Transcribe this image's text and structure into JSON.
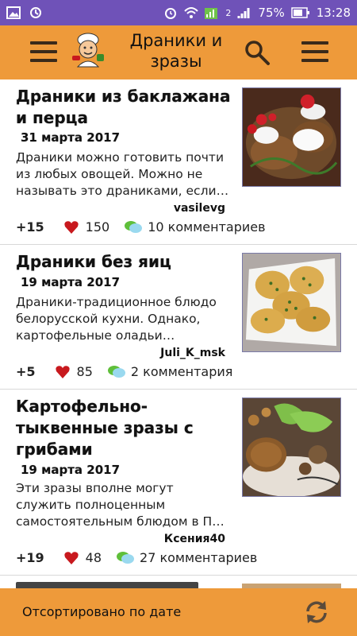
{
  "status_bar": {
    "battery": "75%",
    "time": "13:28",
    "sim_label": "2"
  },
  "app_bar": {
    "title": "Драники и зразы",
    "menu_icon": "hamburger-icon",
    "search_icon": "search-icon"
  },
  "articles": [
    {
      "title": "Драники из баклажана и перца",
      "date": "31 марта 2017",
      "description": "Драники можно готовить почти из любых овощей. Можно не называть это драниками, если…",
      "author": "vasilevg",
      "rating": "+15",
      "likes": "150",
      "comments": "10 комментариев"
    },
    {
      "title": "Драники без яиц",
      "date": "19 марта 2017",
      "description": "Драники-традиционное блюдо белорусской кухни. Однако, картофельные оладьи…",
      "author": "Juli_K_msk",
      "rating": "+5",
      "likes": "85",
      "comments": "2 комментария"
    },
    {
      "title": "Картофельно-тыквенные зразы с грибами",
      "date": "19 марта 2017",
      "description": "Эти зразы вполне могут служить полноценным самостоятельным блюдом в П…",
      "author": "Ксения40",
      "rating": "+19",
      "likes": "48",
      "comments": "27 комментариев"
    }
  ],
  "footer": {
    "sort_label": "Отсортировано по дате",
    "refresh_icon": "refresh-icon"
  },
  "colors": {
    "accent": "#ee9a3a",
    "status_bar": "#6f52b8",
    "heart": "#c8191e"
  }
}
